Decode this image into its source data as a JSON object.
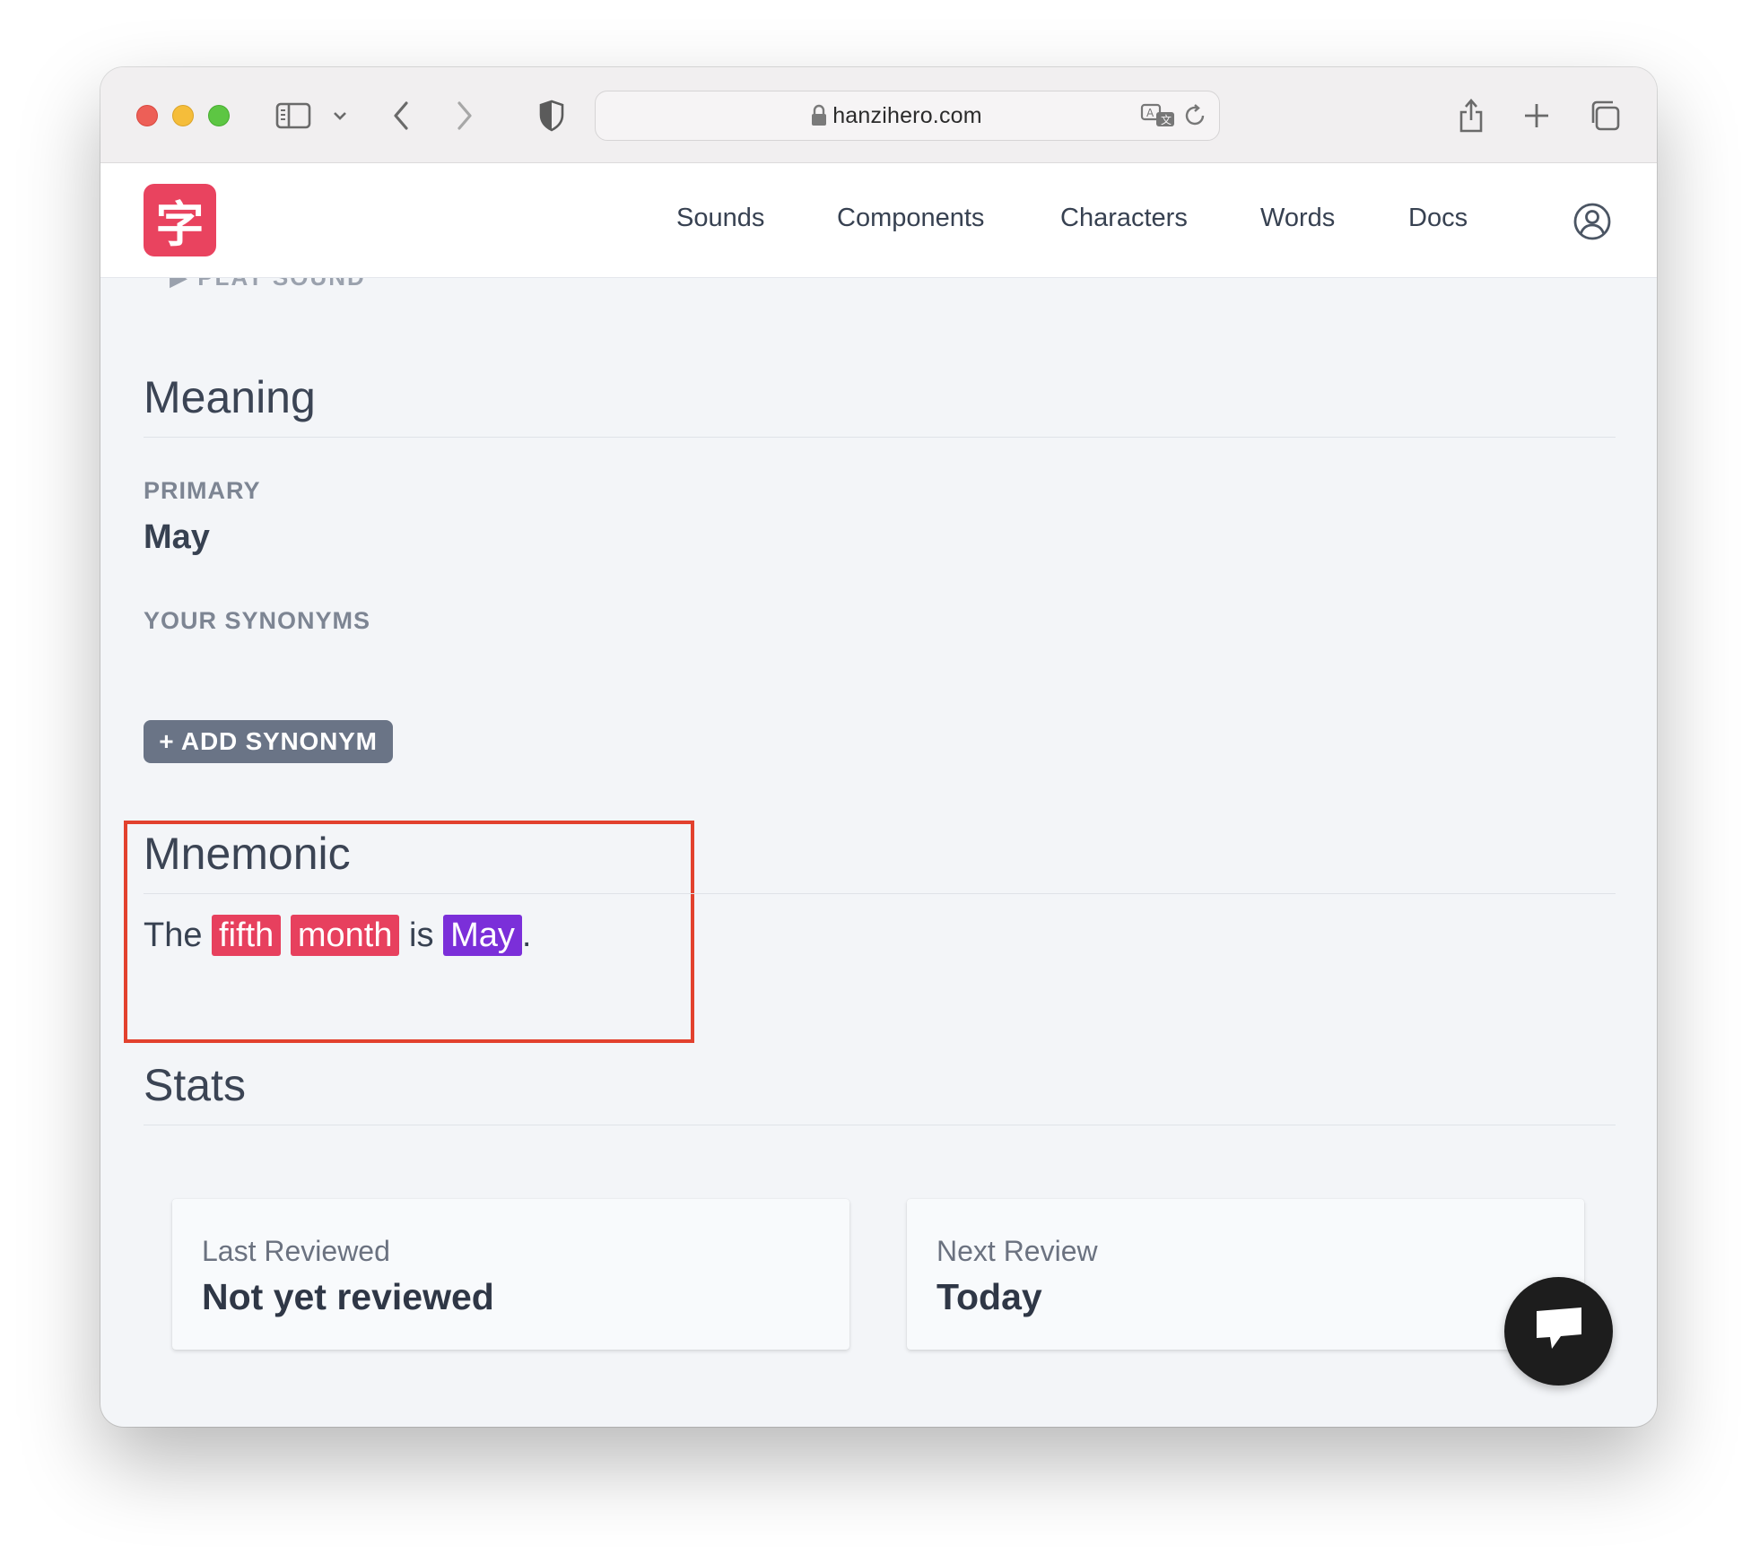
{
  "browser": {
    "url": "hanzihero.com"
  },
  "header": {
    "logo_char": "字",
    "nav": [
      "Sounds",
      "Components",
      "Characters",
      "Words",
      "Docs"
    ]
  },
  "content": {
    "scrolled_hint": "▶ PLAY SOUND",
    "meaning": {
      "title": "Meaning",
      "primary_label": "PRIMARY",
      "primary_value": "May",
      "synonyms_label": "YOUR SYNONYMS",
      "add_synonym_label": "+ ADD SYNONYM"
    },
    "mnemonic": {
      "title": "Mnemonic",
      "parts": {
        "w1": "The",
        "w2": "fifth",
        "w3": "month",
        "w4": "is",
        "w5": "May",
        "w6": "."
      },
      "colors": {
        "component": "#e7405e",
        "meaning": "#7b2fd9"
      }
    },
    "stats": {
      "title": "Stats",
      "last_reviewed_label": "Last Reviewed",
      "last_reviewed_value": "Not yet reviewed",
      "next_review_label": "Next Review",
      "next_review_value": "Today"
    }
  },
  "colors": {
    "brand": "#e9435f",
    "highlight_box": "#e2412e"
  }
}
